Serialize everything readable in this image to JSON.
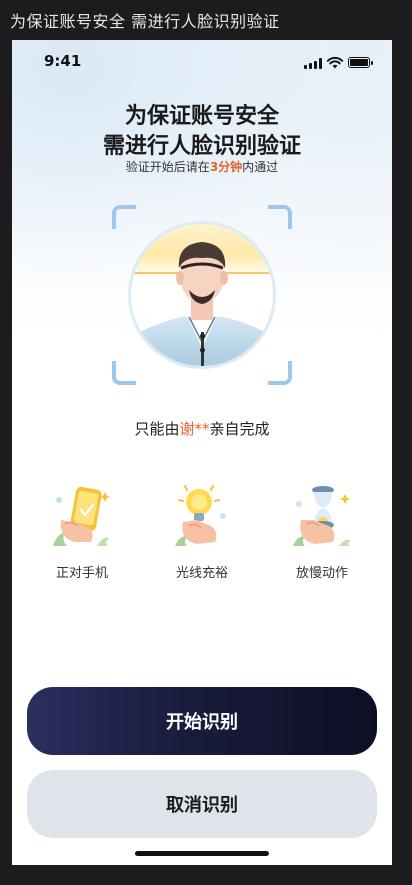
{
  "frame_title": "为保证账号安全 需进行人脸识别验证",
  "status_bar": {
    "time": "9:41"
  },
  "header": {
    "title_line1": "为保证账号安全",
    "title_line2": "需进行人脸识别验证",
    "subtitle_prefix": "验证开始后请在",
    "subtitle_highlight": "3分钟",
    "subtitle_suffix": "内通过"
  },
  "notice": {
    "prefix": "只能由",
    "name": "谢**",
    "suffix": "亲自完成"
  },
  "tips": [
    {
      "label": "正对手机",
      "icon": "hand-holding-phone-icon"
    },
    {
      "label": "光线充裕",
      "icon": "hand-holding-lightbulb-icon"
    },
    {
      "label": "放慢动作",
      "icon": "hand-holding-hourglass-icon"
    }
  ],
  "buttons": {
    "start": "开始识别",
    "cancel": "取消识别"
  },
  "colors": {
    "accent": "#e8622c",
    "scan_frame": "#9fc7ea",
    "primary_button": "#1b1e3f",
    "secondary_button": "#dfe3ea"
  }
}
